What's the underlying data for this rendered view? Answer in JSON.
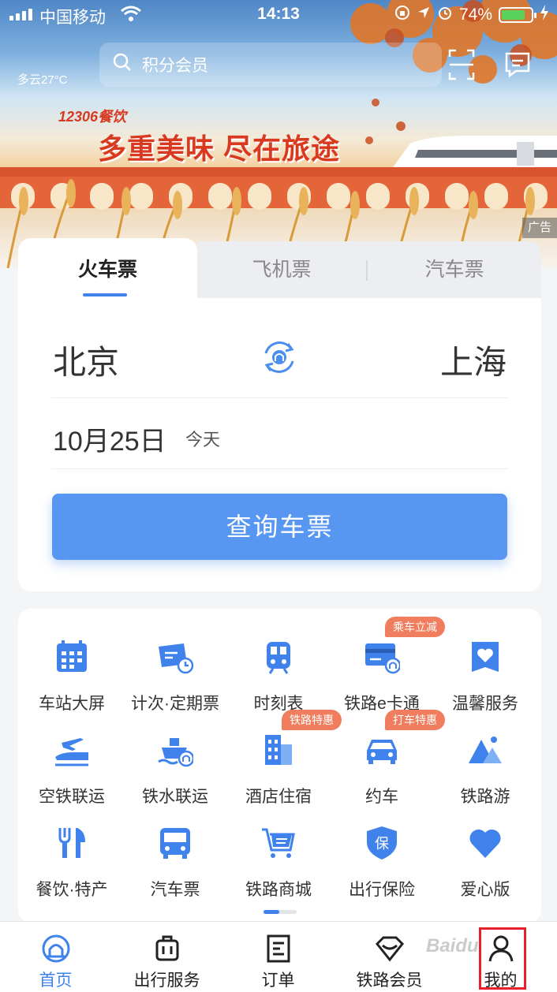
{
  "status_bar": {
    "carrier": "中国移动",
    "time": "14:13",
    "battery": "74%",
    "battery_level": 0.74
  },
  "header": {
    "weather": "多云27°C",
    "search_placeholder": "积分会员"
  },
  "banner": {
    "brand": "12306餐饮",
    "slogan": "多重美味 尽在旅途",
    "ad_tag": "广告"
  },
  "ticket_tabs": [
    {
      "label": "火车票",
      "active": true
    },
    {
      "label": "飞机票",
      "active": false
    },
    {
      "label": "汽车票",
      "active": false
    }
  ],
  "booking": {
    "from_city": "北京",
    "to_city": "上海",
    "date": "10月25日",
    "day": "今天",
    "query_button": "查询车票"
  },
  "services": [
    {
      "label": "车站大屏",
      "icon": "calendar-icon"
    },
    {
      "label": "计次·定期票",
      "icon": "ticket-clock-icon"
    },
    {
      "label": "时刻表",
      "icon": "train-icon"
    },
    {
      "label": "铁路e卡通",
      "icon": "card-icon",
      "badge": "乘车立减"
    },
    {
      "label": "温馨服务",
      "icon": "heart-box-icon"
    },
    {
      "label": "空铁联运",
      "icon": "plane-train-icon"
    },
    {
      "label": "铁水联运",
      "icon": "ship-icon"
    },
    {
      "label": "酒店住宿",
      "icon": "hotel-icon",
      "badge": "铁路特惠"
    },
    {
      "label": "约车",
      "icon": "car-icon",
      "badge": "打车特惠"
    },
    {
      "label": "铁路游",
      "icon": "mountain-icon"
    },
    {
      "label": "餐饮·特产",
      "icon": "cutlery-icon"
    },
    {
      "label": "汽车票",
      "icon": "bus-icon"
    },
    {
      "label": "铁路商城",
      "icon": "cart-icon"
    },
    {
      "label": "出行保险",
      "icon": "shield-icon",
      "shield_text": "保"
    },
    {
      "label": "爱心版",
      "icon": "heart-icon"
    }
  ],
  "bottom_nav": [
    {
      "label": "首页",
      "icon": "railway-logo-icon",
      "active": true
    },
    {
      "label": "出行服务",
      "icon": "luggage-icon"
    },
    {
      "label": "订单",
      "icon": "order-icon"
    },
    {
      "label": "铁路会员",
      "icon": "diamond-icon"
    },
    {
      "label": "我的",
      "icon": "person-icon"
    }
  ],
  "watermark": "Baidu",
  "colors": {
    "accent": "#3f82ec",
    "button": "#5797f1",
    "badge": "#f07e5e",
    "highlight": "#e8202a"
  }
}
